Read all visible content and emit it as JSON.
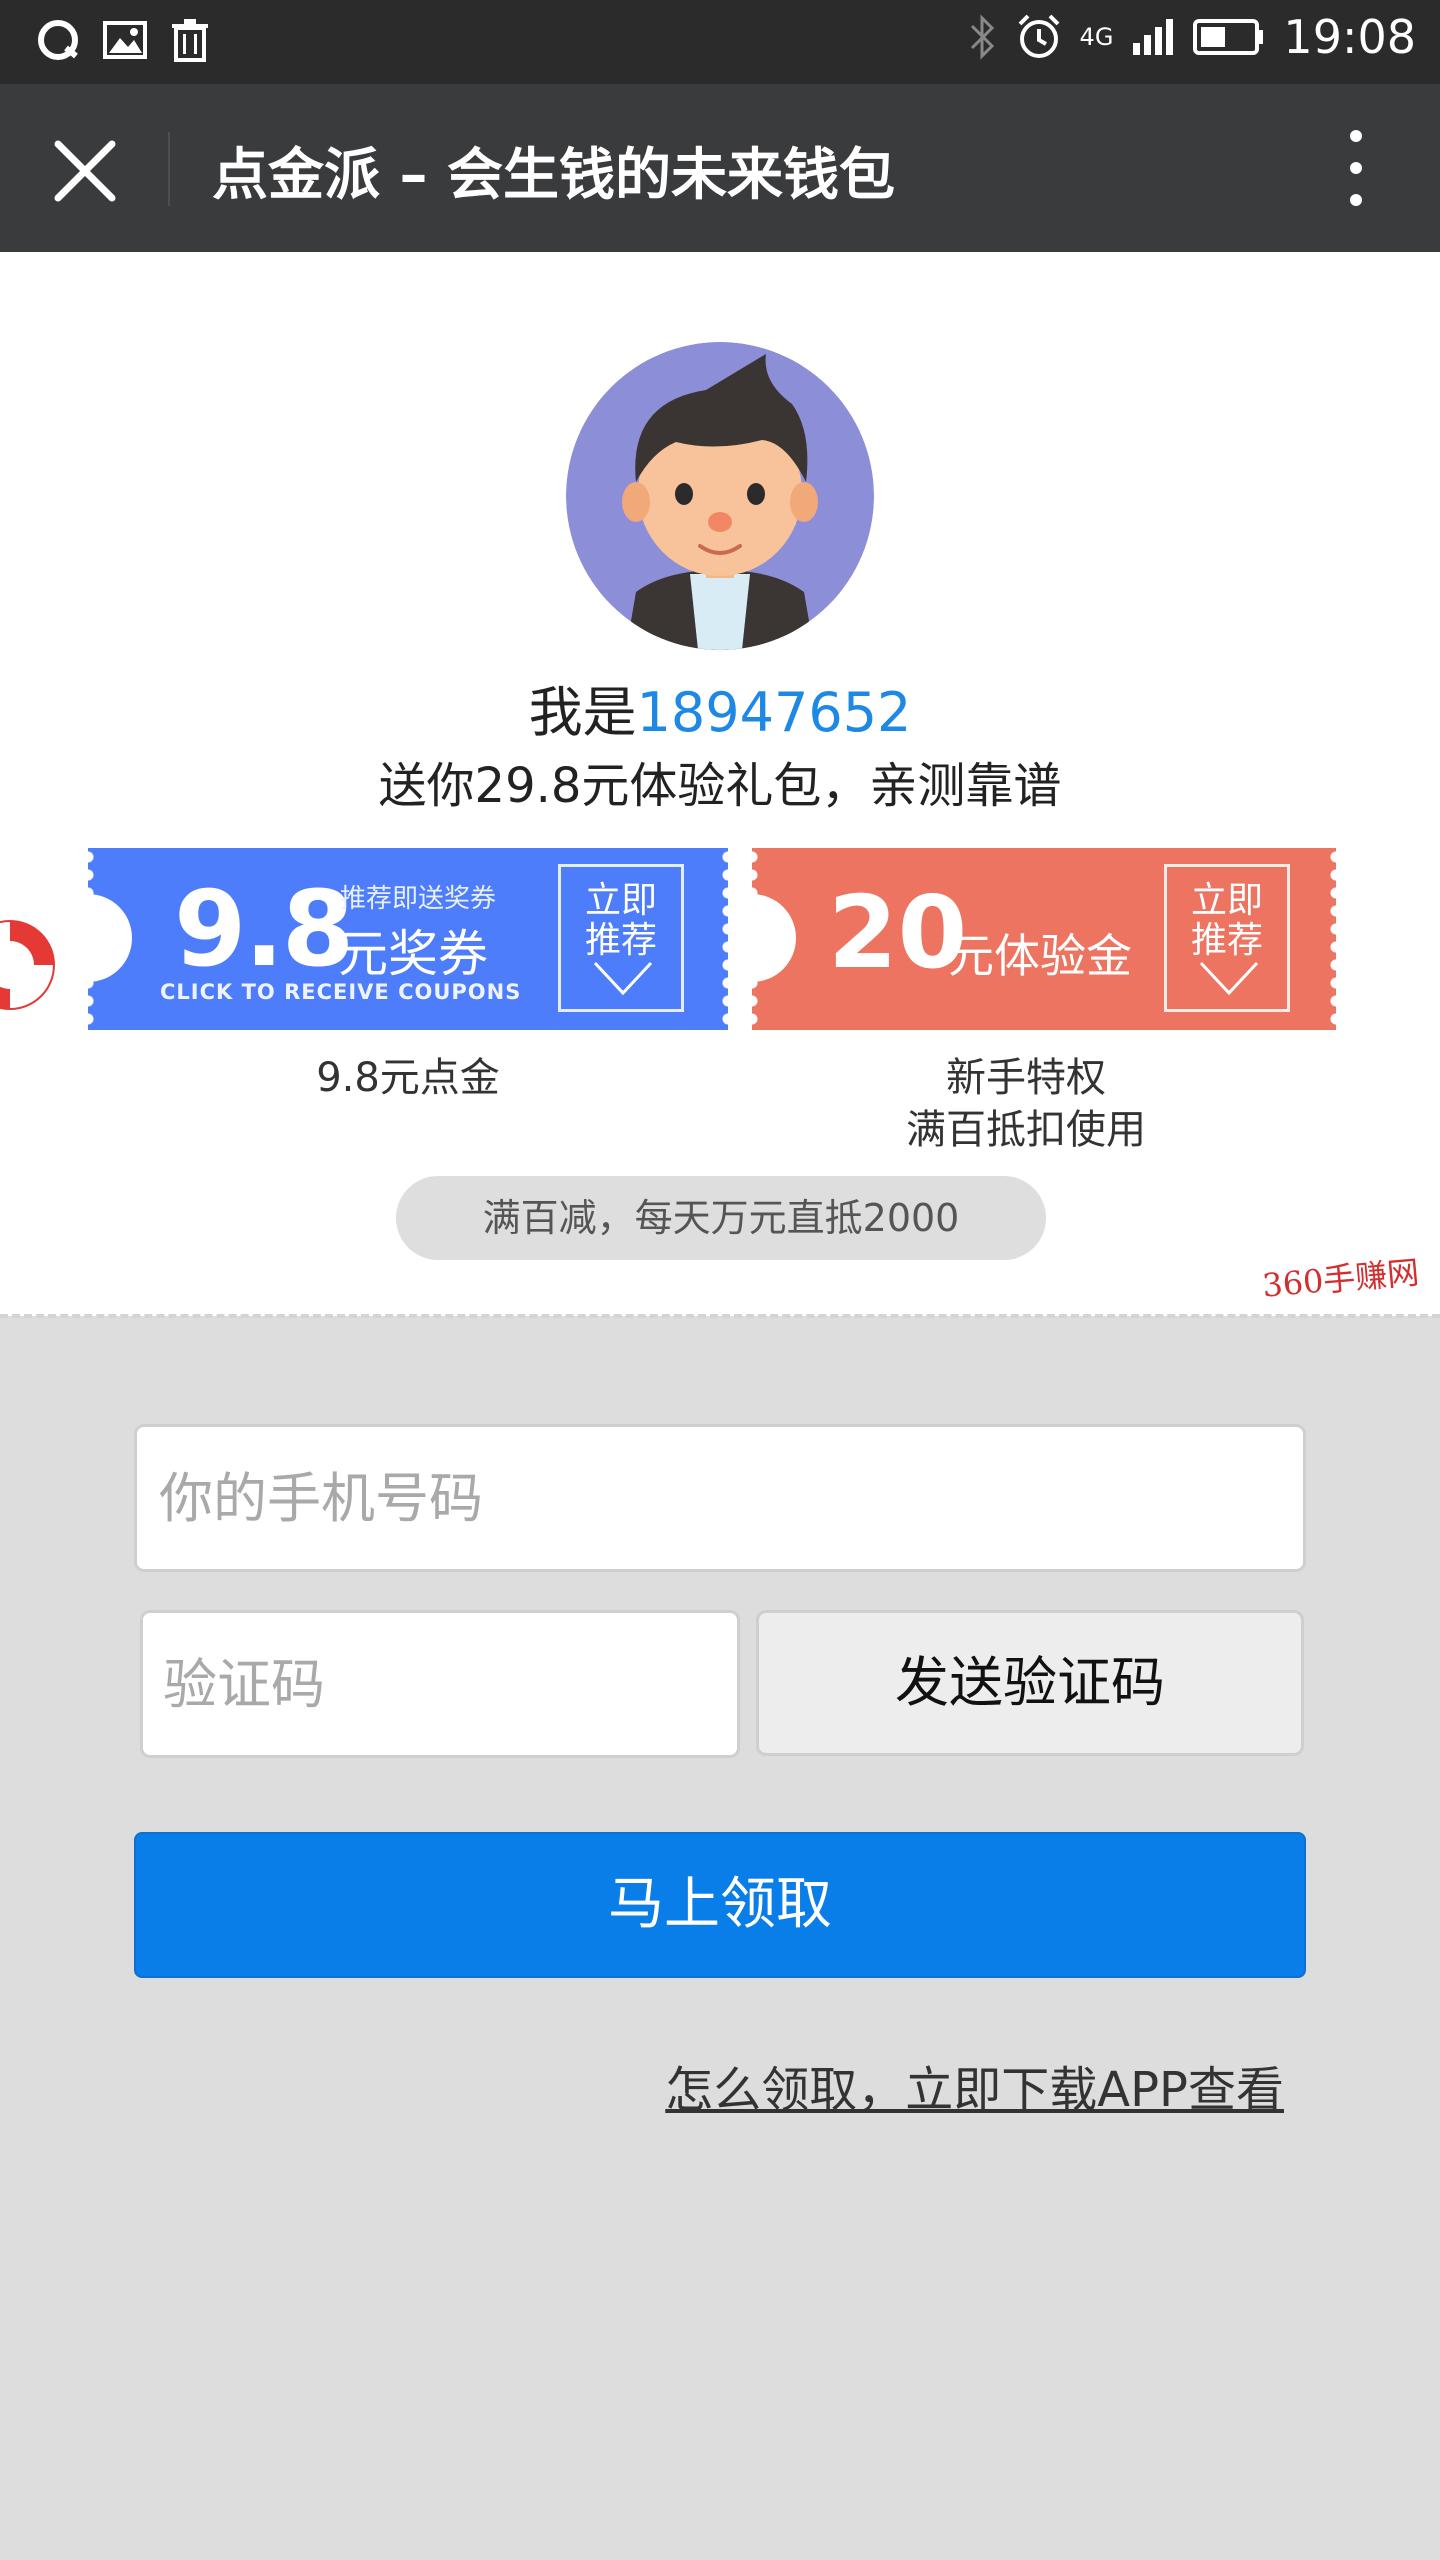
{
  "status_bar": {
    "time": "19:08",
    "network": "4G",
    "left_icons": [
      "qq-icon",
      "image-icon",
      "trash-icon"
    ],
    "right_icons": [
      "bluetooth-icon",
      "alarm-icon",
      "signal-icon",
      "battery-icon"
    ]
  },
  "nav": {
    "title": "点金派 – 会生钱的未来钱包"
  },
  "referral": {
    "prefix": "我是",
    "id": "18947652",
    "subtitle": "送你29.8元体验礼包，亲测靠谱"
  },
  "coupons": [
    {
      "amount": "9.8",
      "top_text": "推荐即送奖券",
      "mid_text": "元奖券",
      "en_text": "CLICK TO RECEIVE COUPONS",
      "tag_line1": "立即",
      "tag_line2": "推荐",
      "caption_line1": "9.8元点金",
      "color": "#4d7dfb"
    },
    {
      "amount": "20",
      "mid_text": "元体验金",
      "tag_line1": "立即",
      "tag_line2": "推荐",
      "caption_line1": "新手特权",
      "caption_line2": "满百抵扣使用",
      "color": "#ec7461"
    }
  ],
  "promo_pill": "满百减，每天万元直抵2000",
  "watermark": "360手赚网",
  "form": {
    "phone_placeholder": "你的手机号码",
    "code_placeholder": "验证码",
    "send_code_label": "发送验证码",
    "submit_label": "马上领取",
    "help_link": "怎么领取，立即下载APP查看"
  },
  "colors": {
    "primary": "#0a7ee8",
    "id_blue": "#1e88e5",
    "status_bar": "#2b2b2b",
    "nav_bar": "#3a3b3d",
    "page_bg": "#dddddd"
  }
}
